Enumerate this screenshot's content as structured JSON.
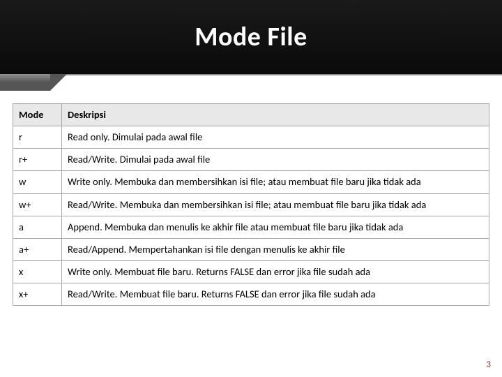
{
  "title": "Mode File",
  "table": {
    "headers": {
      "mode": "Mode",
      "desc": "Deskripsi"
    },
    "rows": [
      {
        "mode": "r",
        "desc": "Read only. Dimulai pada awal file"
      },
      {
        "mode": "r+",
        "desc": "Read/Write. Dimulai pada awal file"
      },
      {
        "mode": "w",
        "desc": "Write only. Membuka dan membersihkan isi file; atau membuat file baru jika tidak ada"
      },
      {
        "mode": "w+",
        "desc": "Read/Write. Membuka dan membersihkan isi file; atau membuat file baru jika tidak ada"
      },
      {
        "mode": "a",
        "desc": "Append. Membuka dan menulis ke akhir file atau membuat file baru jika tidak ada"
      },
      {
        "mode": "a+",
        "desc": "Read/Append. Mempertahankan isi file dengan menulis ke akhir file"
      },
      {
        "mode": "x",
        "desc": "Write only. Membuat file baru. Returns FALSE dan error jika file sudah ada"
      },
      {
        "mode": "x+",
        "desc": "Read/Write. Membuat file baru. Returns FALSE dan error jika file sudah ada"
      }
    ]
  },
  "page_number": "3"
}
